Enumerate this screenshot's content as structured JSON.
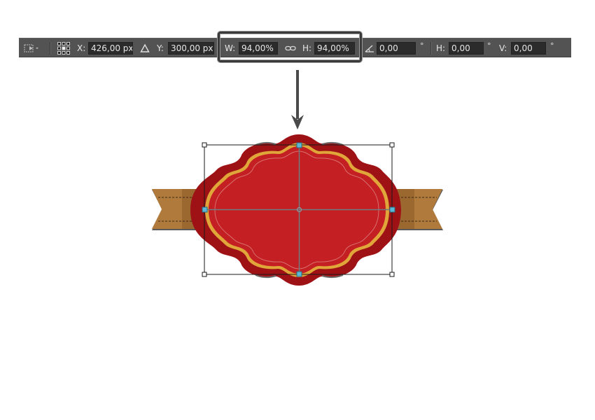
{
  "options_bar": {
    "x_label": "X:",
    "x_value": "426,00 px",
    "y_label": "Y:",
    "y_value": "300,00 px",
    "w_label": "W:",
    "w_value": "94,00%",
    "h_label": "H:",
    "h_value": "94,00%",
    "rotate_value": "0,00",
    "rotate_unit": "°",
    "hskew_label": "H:",
    "hskew_value": "0,00",
    "hskew_unit": "°",
    "vskew_label": "V:",
    "vskew_value": "0,00",
    "vskew_unit": "°"
  },
  "colors": {
    "toolbar_bg": "#535353",
    "badge_red": "#c41f22",
    "badge_dark_red": "#9e1216",
    "badge_gold": "#e0a63a",
    "ribbon_brown": "#b07a3c",
    "selection_handle": "#5bb8d6"
  },
  "icons": [
    "transform-tool-icon",
    "reference-point-grid-icon",
    "delta-icon",
    "link-icon",
    "angle-icon",
    "down-arrow-icon"
  ]
}
